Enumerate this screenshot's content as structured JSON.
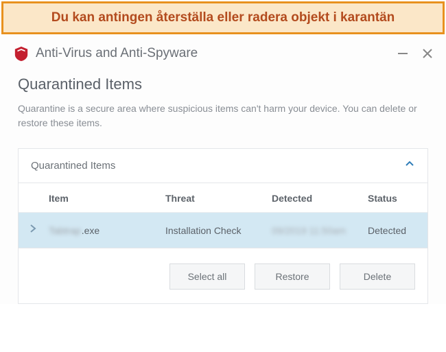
{
  "banner": {
    "text": "Du kan antingen återställa eller radera objekt i karantän"
  },
  "titlebar": {
    "app_title": "Anti-Virus and Anti-Spyware"
  },
  "page": {
    "title": "Quarantined Items",
    "description": "Quarantine is a secure area where suspicious items can't harm your device. You can delete or restore these items."
  },
  "panel": {
    "title": "Quarantined Items"
  },
  "table": {
    "headers": {
      "item": "Item",
      "threat": "Threat",
      "detected": "Detected",
      "status": "Status"
    },
    "rows": [
      {
        "item_prefix": "Tabtrap",
        "item_suffix": ".exe",
        "threat": "Installation Check",
        "detected": "09/2019 11:50am",
        "status": "Detected"
      }
    ]
  },
  "actions": {
    "select_all": "Select all",
    "restore": "Restore",
    "delete": "Delete"
  },
  "colors": {
    "accent": "#c42030",
    "banner_bg": "#fbe7c8",
    "banner_border": "#e8911e",
    "row_selected": "#d3e8f3"
  }
}
